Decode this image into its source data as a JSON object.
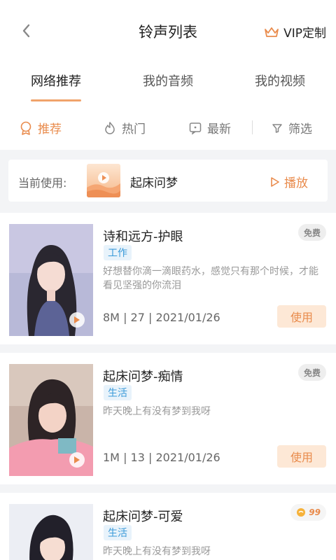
{
  "header": {
    "title": "铃声列表",
    "vip_label": "VIP定制"
  },
  "tabs": [
    {
      "label": "网络推荐",
      "active": true
    },
    {
      "label": "我的音频",
      "active": false
    },
    {
      "label": "我的视频",
      "active": false
    }
  ],
  "filters": [
    {
      "label": "推荐",
      "icon": "badge-icon",
      "active": true
    },
    {
      "label": "热门",
      "icon": "flame-icon",
      "active": false
    },
    {
      "label": "最新",
      "icon": "new-icon",
      "active": false
    },
    {
      "label": "筛选",
      "icon": "filter-icon",
      "active": false
    }
  ],
  "current": {
    "label": "当前使用:",
    "name": "起床问梦",
    "play_label": "播放"
  },
  "items": [
    {
      "title": "诗和远方-护眼",
      "tag": "工作",
      "desc": "好想替你滴一滴眼药水，感觉只有那个时候，才能看见坚强的你流泪",
      "meta": "8M | 27 | 2021/01/26",
      "use_label": "使用",
      "badge": "免费"
    },
    {
      "title": "起床问梦-痴情",
      "tag": "生活",
      "desc": "昨天晚上有没有梦到我呀",
      "meta": "1M | 13 | 2021/01/26",
      "use_label": "使用",
      "badge": "免费"
    },
    {
      "title": "起床问梦-可爱",
      "tag": "生活",
      "desc": "昨天晚上有没有梦到我呀",
      "badge": "99"
    }
  ],
  "colors": {
    "accent": "#e98b4c",
    "tag_blue": "#3a9ad9"
  }
}
